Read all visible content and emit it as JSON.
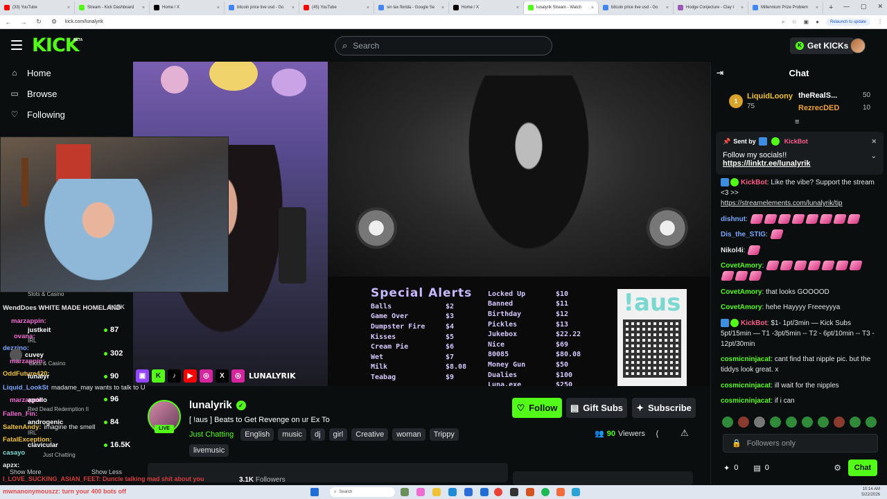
{
  "browser": {
    "tabs": [
      {
        "label": "(33) YouTube",
        "color": "#ff0000"
      },
      {
        "label": "Stream - Kick Dashboard",
        "color": "#53fc18"
      },
      {
        "label": "Home / X",
        "color": "#000000"
      },
      {
        "label": "bitcoin price live usd - Go",
        "color": "#4285f4"
      },
      {
        "label": "(45) YouTube",
        "color": "#ff0000"
      },
      {
        "label": "sin tax florida - Google Se",
        "color": "#4285f4"
      },
      {
        "label": "Home / X",
        "color": "#000000"
      },
      {
        "label": "lunalyrik Stream - Watch",
        "color": "#53fc18",
        "active": true
      },
      {
        "label": "bitcoin price live usd - Go",
        "color": "#4285f4"
      },
      {
        "label": "Hodge Conjecture - Clay I",
        "color": "#9b59b6"
      },
      {
        "label": "Millennium Prize Problem",
        "color": "#4285f4"
      }
    ],
    "url": "kick.com/lunalyrik",
    "relaunch": "Relaunch to update"
  },
  "header": {
    "logo": "KICK",
    "logo_beta": "BETA",
    "search_placeholder": "Search",
    "get_kicks": "Get KICKs"
  },
  "sidebar": {
    "items": [
      {
        "label": "Home",
        "icon": "home-icon",
        "glyph": "⌂"
      },
      {
        "label": "Browse",
        "icon": "browse-icon",
        "glyph": "▭"
      },
      {
        "label": "Following",
        "icon": "heart-icon",
        "glyph": "♡"
      }
    ]
  },
  "video": {
    "alerts_title": "Special Alerts",
    "alerts_left": [
      {
        "name": "Balls",
        "price": "$2"
      },
      {
        "name": "Game Over",
        "price": "$3"
      },
      {
        "name": "Dumpster Fire",
        "price": "$4"
      },
      {
        "name": "Kisses",
        "price": "$5"
      },
      {
        "name": "Cream Pie",
        "price": "$6"
      },
      {
        "name": "Wet",
        "price": "$7"
      },
      {
        "name": "Milk",
        "price": "$8.08"
      },
      {
        "name": "Teabag",
        "price": "$9"
      }
    ],
    "alerts_right": [
      {
        "name": "Locked Up",
        "price": "$10"
      },
      {
        "name": "Banned",
        "price": "$11"
      },
      {
        "name": "Birthday",
        "price": "$12"
      },
      {
        "name": "Pickles",
        "price": "$13"
      },
      {
        "name": "Jukebox",
        "price": "$22.22"
      },
      {
        "name": "Nice",
        "price": "$69"
      },
      {
        "name": "80085",
        "price": "$80.08"
      },
      {
        "name": "Money Gun",
        "price": "$50"
      },
      {
        "name": "Dualies",
        "price": "$100"
      },
      {
        "name": "Luna.exe",
        "price": "$250"
      }
    ],
    "aus_text": "!aus",
    "social_handle": "LUNALYRIK"
  },
  "overlay_chat": {
    "cat1": "Slots & Casino",
    "line1": "WendDoes WHITE MADE HOMELAND",
    "n1": "3,17K",
    "u2": "marzappin:",
    "u3": "justkeit",
    "n3": "87",
    "u4": "ovana:",
    "cat4": "IRL",
    "u5": "dezzino:",
    "u6": "cuvey",
    "n6": "302",
    "u7": "marzappin:",
    "cat7": "Slots & Casino",
    "u8": "OddFuture420:",
    "u9": "lunalyr",
    "n9": "90",
    "u10": "Liquid_LookSt",
    "line10": "madame_may wants to talk to U",
    "u11": "marzappin",
    "u12": "apollo",
    "n12": "96",
    "cat12": "Red Dead Redemption II",
    "u13": "Fallen_Fin:",
    "u14": "androgenic",
    "n14": "84",
    "u15": "SaltenAndy:",
    "line15": "imagine the smell",
    "cat15": "IRL",
    "u16": "FatalException:",
    "u17": "clavicular",
    "n17": "16.5K",
    "u18": "casayo",
    "cat18": "Just Chatting",
    "u19": "apzx:",
    "show_more": "Show More",
    "show_less": "Show Less",
    "ticker1": "I_LOVE_SUCKING_ASIAN_FEET: Duncle talking mad shit about you",
    "ticker2": "mwnanonymouszz: turn your 400 bots off"
  },
  "stream": {
    "name": "lunalyrik",
    "title": "[ !aus ] Beats to Get Revenge on ur Ex To",
    "category": "Just Chatting",
    "tags": [
      "English",
      "music",
      "dj",
      "girl",
      "Creative",
      "woman",
      "Trippy",
      "livemusic"
    ],
    "live": "LIVE",
    "follow": "Follow",
    "gift_subs": "Gift Subs",
    "subscribe": "Subscribe",
    "viewers_count": "90",
    "viewers_label": "Viewers",
    "followers_count": "3.1K",
    "followers_label": "Followers"
  },
  "chat": {
    "title": "Chat",
    "leaderboard": {
      "first_rank": "1",
      "first_name": "LiquidLoony",
      "first_value": "75",
      "second_name": "theRealS...",
      "second_value": "50",
      "third_name": "RezrecDED",
      "third_value": "10"
    },
    "pinned": {
      "sent_by": "Sent by",
      "bot": "KickBot",
      "message": "Follow my socials!!",
      "link": "https://linktr.ee/lunalyrik"
    },
    "messages": [
      {
        "user": "KickBot",
        "color": "#ff5c8a",
        "bot": true,
        "text": ": Like the vibe? Support the stream <3 >>",
        "link": "https://streamelements.com/lunalyrik/tip"
      },
      {
        "user": "dishnut",
        "color": "#7aa7ff",
        "text": ": ",
        "emotes": 8
      },
      {
        "user": "Dis_the_STIG",
        "color": "#7aa7ff",
        "text": ": ",
        "emotes": 1
      },
      {
        "user": "Nikol4i",
        "color": "#e6e6e6",
        "text": ": ",
        "emotes": 1
      },
      {
        "user": "CovetAmory",
        "color": "#53fc18",
        "text": ": ",
        "emotes": 10
      },
      {
        "user": "CovetAmory",
        "color": "#53fc18",
        "text": ": that looks GOOOOD"
      },
      {
        "user": "CovetAmory",
        "color": "#53fc18",
        "text": ": hehe Hayyyy Freeeyyya"
      },
      {
        "user": "KickBot",
        "color": "#ff5c8a",
        "bot": true,
        "text": ": $1- 1pt/3min — Kick Subs 5pt/15min — T1 -3pt/5min -- T2 - 6pt/10min -- T3 - 12pt/30min"
      },
      {
        "user": "cosmicninjacat",
        "color": "#53fc18",
        "text": ": cant find that nipple pic. but the tiddys look great. x"
      },
      {
        "user": "cosmicninjacat",
        "color": "#53fc18",
        "text": ": ill wait for the nipples"
      },
      {
        "user": "cosmicninjacat",
        "color": "#53fc18",
        "text": ": if i can"
      }
    ],
    "input_placeholder": "Followers only",
    "kicks_count": "0",
    "gift_count": "0",
    "send": "Chat"
  },
  "taskbar": {
    "search": "Search",
    "time": "10:14 AM",
    "date": "5/22/2026"
  }
}
